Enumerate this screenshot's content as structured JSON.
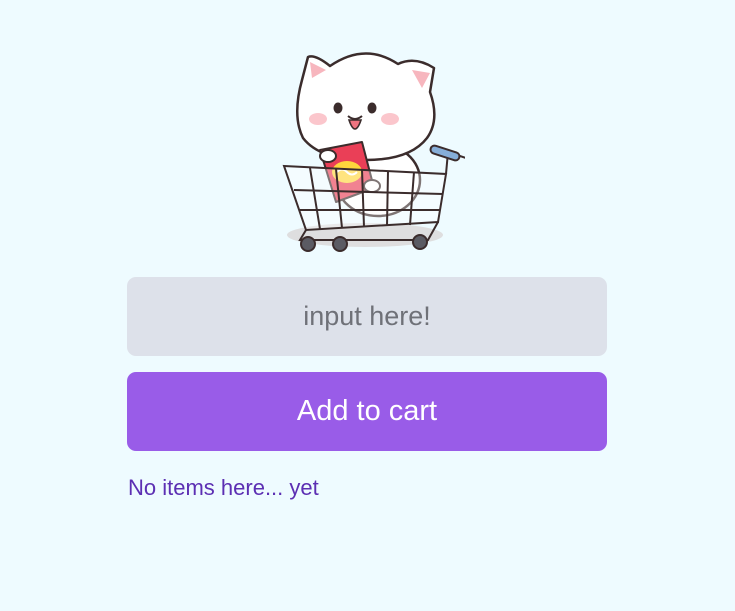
{
  "mascot": {
    "icon": "cat-in-shopping-cart-illustration"
  },
  "input": {
    "placeholder": "input here!",
    "value": ""
  },
  "add_button": {
    "label": "Add to cart",
    "color": "#995ce8"
  },
  "list": {
    "empty_message": "No items here... yet"
  },
  "colors": {
    "background": "#eefbff",
    "input_background": "#dde1ea",
    "accent": "#995ce8",
    "empty_text": "#5c2fb3"
  }
}
